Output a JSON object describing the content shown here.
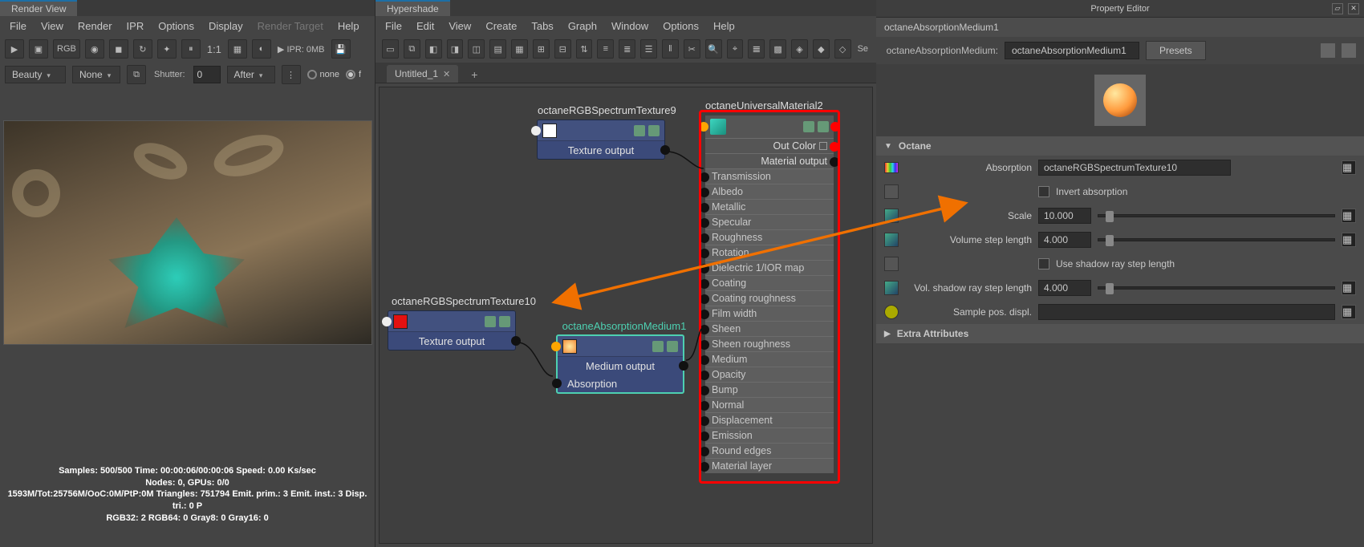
{
  "render_view": {
    "title": "Render View",
    "menu": [
      "File",
      "View",
      "Render",
      "IPR",
      "Options",
      "Display",
      "Render Target",
      "Help"
    ],
    "ipr_label": "IPR: 0MB",
    "ratio": "1:1",
    "rgb": "RGB",
    "channel_dd": "Beauty",
    "none_dd": "None",
    "shutter_label": "Shutter:",
    "shutter_val": "0",
    "after_dd": "After",
    "radio_none": "none",
    "radio_f": "f",
    "stats": [
      "Samples: 500/500  Time: 00:00:06/00:00:06  Speed: 0.00 Ks/sec",
      "Nodes: 0, GPUs: 0/0",
      "1593M/Tot:25756M/OoC:0M/PtP:0M  Triangles: 751794  Emit. prim.: 3  Emit. inst.: 3  Disp. tri.: 0  P",
      "RGB32: 2  RGB64: 0  Gray8: 0  Gray16: 0"
    ]
  },
  "hypershade": {
    "title": "Hypershade",
    "menu": [
      "File",
      "Edit",
      "View",
      "Create",
      "Tabs",
      "Graph",
      "Window",
      "Options",
      "Help"
    ],
    "tab": "Untitled_1",
    "se_label": "Se",
    "nodes": {
      "tex9": {
        "title": "octaneRGBSpectrumTexture9",
        "out": "Texture output"
      },
      "tex10": {
        "title": "octaneRGBSpectrumTexture10",
        "out": "Texture output"
      },
      "medium": {
        "title": "octaneAbsorptionMedium1",
        "out": "Medium output",
        "in": "Absorption"
      },
      "material": {
        "title": "octaneUniversalMaterial2",
        "out_color": "Out Color",
        "mat_out": "Material output",
        "inputs": [
          "Transmission",
          "Albedo",
          "Metallic",
          "Specular",
          "Roughness",
          "Rotation",
          "Dielectric 1/IOR map",
          "Coating",
          "Coating roughness",
          "Film width",
          "Sheen",
          "Sheen roughness",
          "Medium",
          "Opacity",
          "Bump",
          "Normal",
          "Displacement",
          "Emission",
          "Round edges",
          "Material layer"
        ]
      }
    }
  },
  "property_editor": {
    "title": "Property Editor",
    "node_name": "octaneAbsorptionMedium1",
    "type_label": "octaneAbsorptionMedium:",
    "type_value": "octaneAbsorptionMedium1",
    "presets": "Presets",
    "sections": {
      "octane": {
        "label": "Octane",
        "absorption_lbl": "Absorption",
        "absorption_val": "octaneRGBSpectrumTexture10",
        "invert_lbl": "Invert absorption",
        "scale_lbl": "Scale",
        "scale_val": "10.000",
        "vsl_lbl": "Volume step length",
        "vsl_val": "4.000",
        "shadow_chk_lbl": "Use shadow ray step length",
        "vssl_lbl": "Vol. shadow ray step length",
        "vssl_val": "4.000",
        "sample_lbl": "Sample pos. displ."
      },
      "extra": {
        "label": "Extra Attributes"
      }
    }
  }
}
